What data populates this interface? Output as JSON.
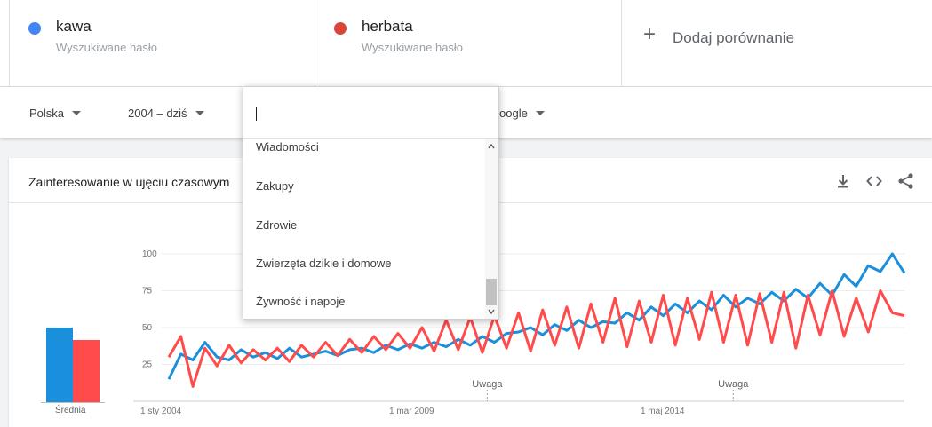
{
  "terms": [
    {
      "name": "kawa",
      "subtitle": "Wyszukiwane hasło",
      "color": "#4285f4"
    },
    {
      "name": "herbata",
      "subtitle": "Wyszukiwane hasło",
      "color": "#db4437"
    }
  ],
  "add_comparison": {
    "icon": "+",
    "label": "Dodaj porównanie"
  },
  "filters": {
    "region": "Polska",
    "period": "2004 – dziś",
    "source": "oogle"
  },
  "category_search": {
    "value": "",
    "placeholder": ""
  },
  "category_options": [
    "Wiadomości",
    "Zakupy",
    "Zdrowie",
    "Zwierzęta dzikie i domowe",
    "Żywność i napoje"
  ],
  "card": {
    "title": "Zainteresowanie w ujęciu czasowym"
  },
  "icons": {
    "download": "download-icon",
    "embed": "embed-code-icon",
    "share": "share-icon"
  },
  "chart_data": {
    "type": "line",
    "y_ticks": [
      "100",
      "75",
      "50",
      "25"
    ],
    "ylim": [
      0,
      100
    ],
    "x_labels": [
      "1 sty 2004",
      "1 mar 2009",
      "1 maj 2014"
    ],
    "notes": [
      "Uwaga",
      "Uwaga"
    ],
    "average_label": "Średnia",
    "averages": [
      {
        "term": "kawa",
        "value": 50,
        "color": "#1a8fdc"
      },
      {
        "term": "herbata",
        "value": 42,
        "color": "#ff4b4b"
      }
    ],
    "series": [
      {
        "name": "kawa",
        "color": "#1a8fdc",
        "x": [
          2004.0,
          2004.25,
          2004.5,
          2004.75,
          2005.0,
          2005.25,
          2005.5,
          2005.75,
          2006.0,
          2006.25,
          2006.5,
          2006.75,
          2007.0,
          2007.25,
          2007.5,
          2007.75,
          2008.0,
          2008.25,
          2008.5,
          2008.75,
          2009.0,
          2009.25,
          2009.5,
          2009.75,
          2010.0,
          2010.25,
          2010.5,
          2010.75,
          2011.0,
          2011.25,
          2011.5,
          2011.75,
          2012.0,
          2012.25,
          2012.5,
          2012.75,
          2013.0,
          2013.25,
          2013.5,
          2013.75,
          2014.0,
          2014.25,
          2014.5,
          2014.75,
          2015.0,
          2015.25,
          2015.5,
          2015.75,
          2016.0,
          2016.25,
          2016.5,
          2016.75,
          2017.0,
          2017.25,
          2017.5,
          2017.75,
          2018.0,
          2018.25,
          2018.5,
          2018.75,
          2019.0,
          2019.25
        ],
        "values": [
          15,
          32,
          28,
          40,
          30,
          28,
          35,
          30,
          33,
          29,
          36,
          30,
          32,
          34,
          31,
          35,
          36,
          33,
          38,
          35,
          39,
          36,
          40,
          37,
          42,
          38,
          44,
          40,
          46,
          47,
          50,
          45,
          52,
          48,
          55,
          50,
          54,
          53,
          60,
          55,
          64,
          58,
          66,
          60,
          68,
          62,
          72,
          64,
          70,
          66,
          74,
          68,
          76,
          70,
          80,
          72,
          86,
          78,
          92,
          88,
          100,
          87
        ]
      },
      {
        "name": "herbata",
        "color": "#ff4b4b",
        "x": [
          2004.0,
          2004.25,
          2004.5,
          2004.75,
          2005.0,
          2005.25,
          2005.5,
          2005.75,
          2006.0,
          2006.25,
          2006.5,
          2006.75,
          2007.0,
          2007.25,
          2007.5,
          2007.75,
          2008.0,
          2008.25,
          2008.5,
          2008.75,
          2009.0,
          2009.25,
          2009.5,
          2009.75,
          2010.0,
          2010.25,
          2010.5,
          2010.75,
          2011.0,
          2011.25,
          2011.5,
          2011.75,
          2012.0,
          2012.25,
          2012.5,
          2012.75,
          2013.0,
          2013.25,
          2013.5,
          2013.75,
          2014.0,
          2014.25,
          2014.5,
          2014.75,
          2015.0,
          2015.25,
          2015.5,
          2015.75,
          2016.0,
          2016.25,
          2016.5,
          2016.75,
          2017.0,
          2017.25,
          2017.5,
          2017.75,
          2018.0,
          2018.25,
          2018.5,
          2018.75,
          2019.0,
          2019.25
        ],
        "values": [
          30,
          44,
          10,
          36,
          24,
          38,
          26,
          35,
          28,
          36,
          27,
          38,
          30,
          40,
          31,
          42,
          33,
          44,
          35,
          46,
          36,
          50,
          34,
          55,
          35,
          57,
          33,
          58,
          36,
          60,
          34,
          62,
          38,
          64,
          36,
          66,
          40,
          70,
          37,
          68,
          40,
          72,
          38,
          70,
          42,
          74,
          40,
          72,
          38,
          73,
          40,
          74,
          36,
          72,
          45,
          75,
          44,
          70,
          47,
          75,
          60,
          58
        ]
      }
    ]
  }
}
